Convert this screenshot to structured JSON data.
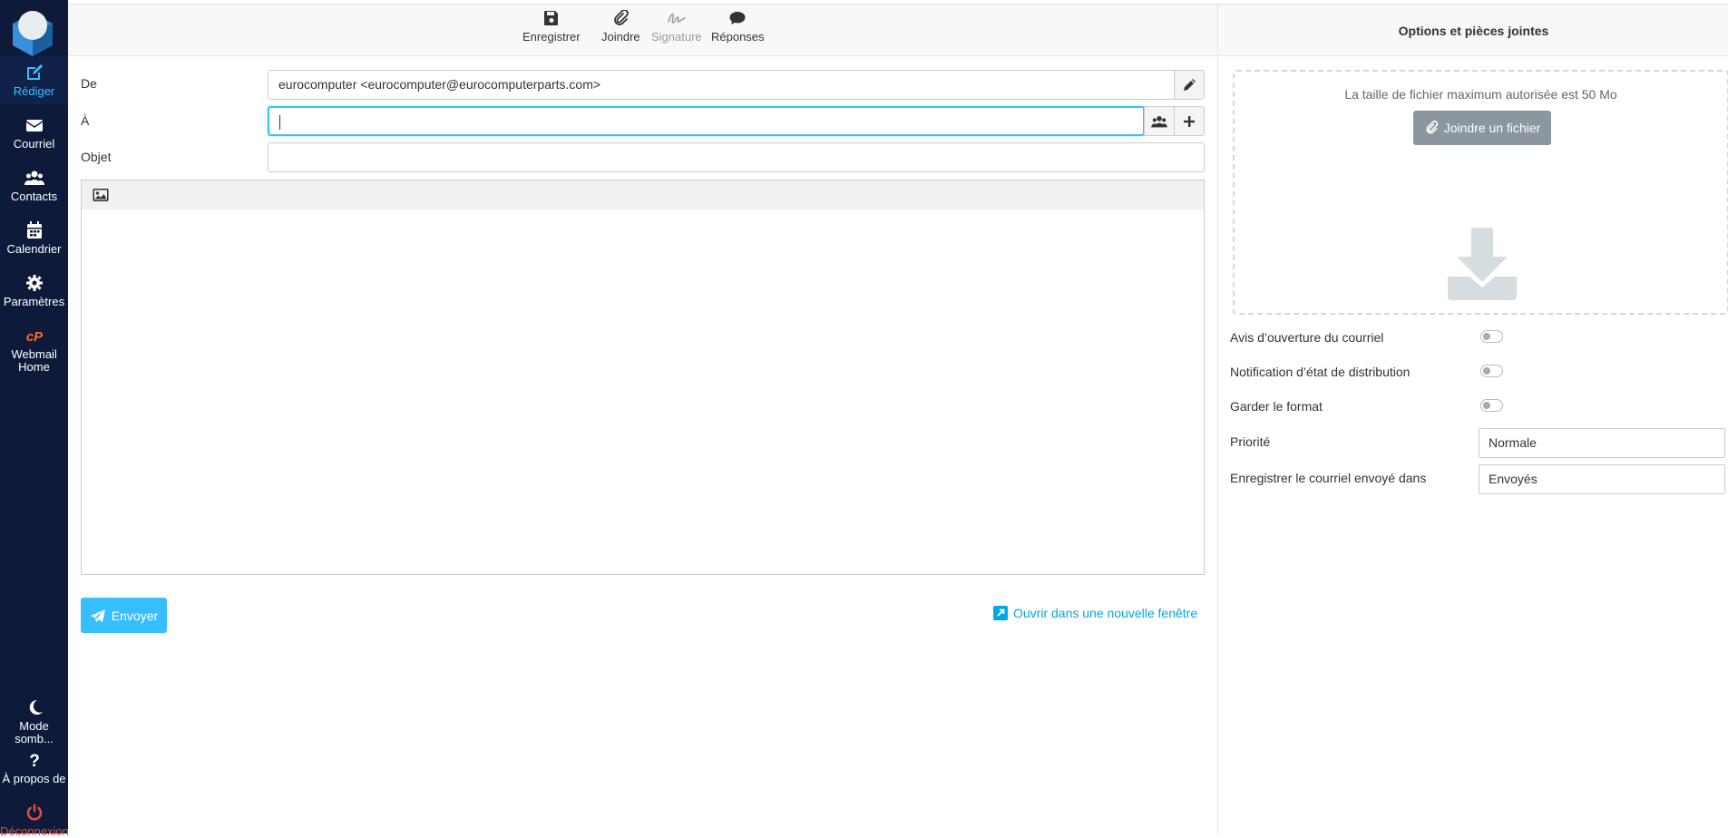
{
  "sidebar": {
    "items": [
      {
        "label": "Rédiger",
        "icon": "compose-icon"
      },
      {
        "label": "Courriel",
        "icon": "envelope-icon"
      },
      {
        "label": "Contacts",
        "icon": "users-icon"
      },
      {
        "label": "Calendrier",
        "icon": "calendar-icon"
      },
      {
        "label": "Paramètres",
        "icon": "gear-icon"
      },
      {
        "label": "Webmail Home",
        "icon": "cpanel-icon"
      }
    ],
    "bottom": [
      {
        "label": "Mode somb...",
        "icon": "moon-icon"
      },
      {
        "label": "À propos de",
        "icon": "question-icon"
      },
      {
        "label": "Déconnexion",
        "icon": "power-icon"
      }
    ]
  },
  "toolbar": {
    "save": "Enregistrer",
    "attach": "Joindre",
    "signature": "Signature",
    "responses": "Réponses"
  },
  "compose": {
    "from_label": "De",
    "from_value": "eurocomputer <eurocomputer@eurocomputerparts.com>",
    "to_label": "À",
    "to_value": "",
    "subject_label": "Objet",
    "subject_value": "",
    "send_label": "Envoyer",
    "new_window_label": "Ouvrir dans une nouvelle fenêtre"
  },
  "options": {
    "header": "Options et pièces jointes",
    "max_size_text": "La taille de fichier maximum autorisée est 50 Mo",
    "attach_button": "Joindre un fichier",
    "read_receipt": "Avis d’ouverture du courriel",
    "delivery_status": "Notification d’état de distribution",
    "keep_format": "Garder le format",
    "priority_label": "Priorité",
    "priority_value": "Normale",
    "save_sent_label": "Enregistrer le courriel envoyé dans",
    "save_sent_value": "Envoyés"
  },
  "colors": {
    "sidebar_bg": "#0d1a3a",
    "accent": "#37beff",
    "link": "#00a7e6",
    "logout": "#e74c3c"
  }
}
